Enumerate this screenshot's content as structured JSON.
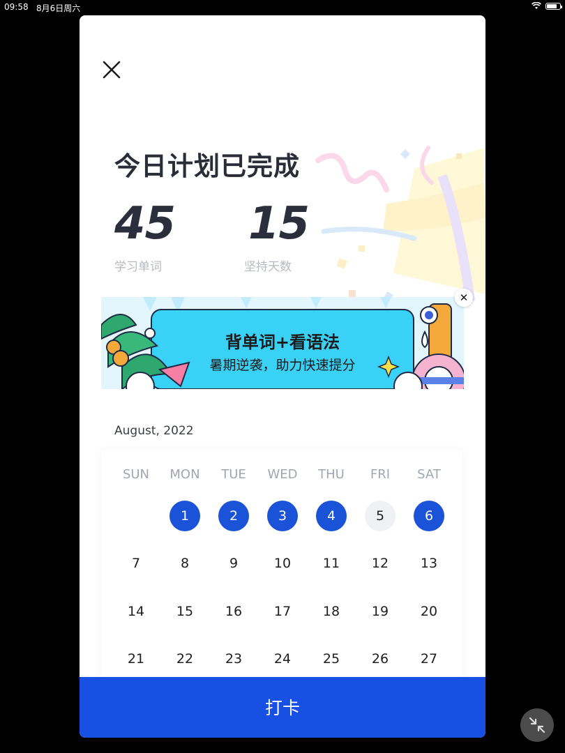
{
  "status_bar": {
    "time": "09:58",
    "date": "8月6日周六",
    "battery_level": 0.8
  },
  "modal": {
    "title": "今日计划已完成",
    "stats": [
      {
        "value": "45",
        "label": "学习单词"
      },
      {
        "value": "15",
        "label": "坚持天数"
      }
    ],
    "banner": {
      "headline": "背单词+看语法",
      "subline": "暑期逆袭，助力快速提分"
    },
    "calendar": {
      "month": "August, 2022",
      "weekdays": [
        "SUN",
        "MON",
        "TUE",
        "WED",
        "THU",
        "FRI",
        "SAT"
      ],
      "weeks": [
        [
          "",
          "1",
          "2",
          "3",
          "4",
          "5",
          "6"
        ],
        [
          "7",
          "8",
          "9",
          "10",
          "11",
          "12",
          "13"
        ],
        [
          "14",
          "15",
          "16",
          "17",
          "18",
          "19",
          "20"
        ],
        [
          "21",
          "22",
          "23",
          "24",
          "25",
          "26",
          "27"
        ]
      ],
      "checked_days": [
        "1",
        "2",
        "3",
        "4",
        "6"
      ],
      "today": "5",
      "accent": "#1a52d8"
    },
    "checkin_button": "打卡"
  }
}
